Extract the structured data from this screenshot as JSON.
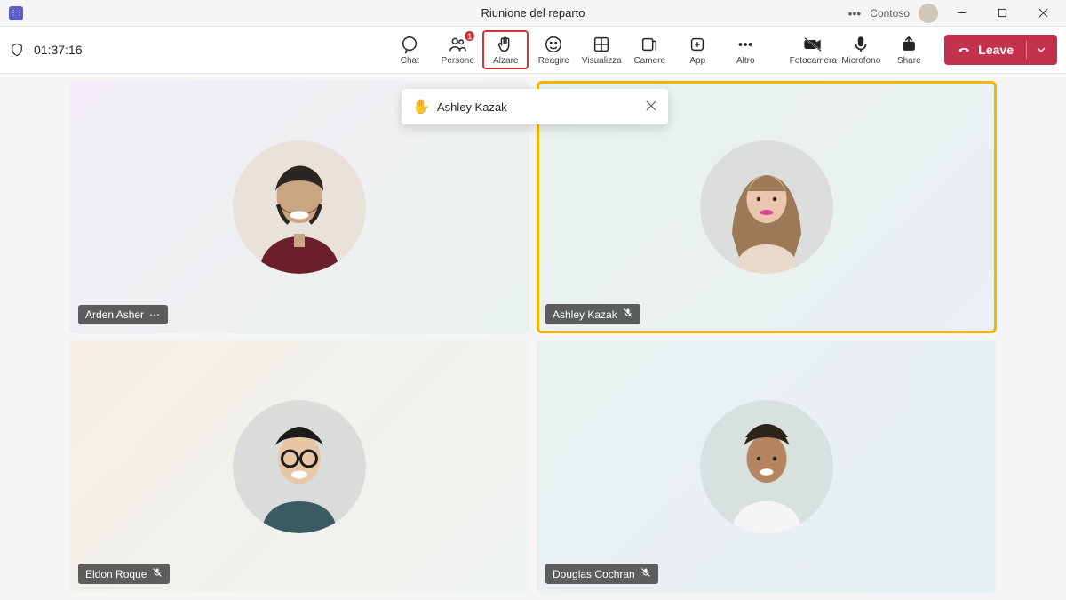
{
  "titlebar": {
    "title": "Riunione del reparto",
    "org": "Contoso"
  },
  "toolbar": {
    "timer": "01:37:16",
    "chat": "Chat",
    "people": "Persone",
    "people_badge": "1",
    "raise": "Alzare",
    "react": "Reagire",
    "view": "Visualizza",
    "rooms": "Camere",
    "apps": "App",
    "more": "Altro",
    "camera": "Fotocamera",
    "mic": "Microfono",
    "share": "Share",
    "leave": "Leave"
  },
  "popup": {
    "hand": "✋",
    "name": "Ashley Kazak"
  },
  "participants": [
    {
      "name": "Arden Asher",
      "muted": false,
      "more": true,
      "raised": false
    },
    {
      "name": "Ashley Kazak",
      "muted": true,
      "more": false,
      "raised": true
    },
    {
      "name": "Eldon Roque",
      "muted": true,
      "more": false,
      "raised": false
    },
    {
      "name": "Douglas Cochran",
      "muted": true,
      "more": false,
      "raised": false
    }
  ]
}
